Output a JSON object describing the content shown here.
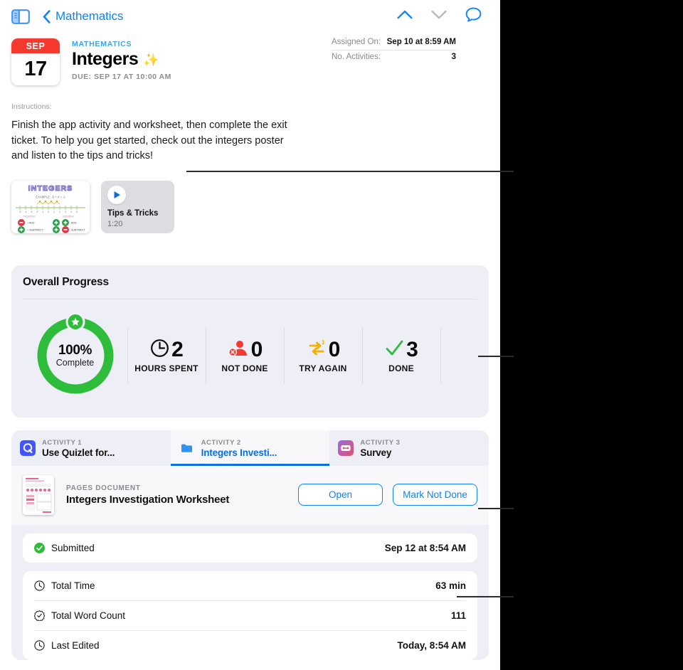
{
  "navbar": {
    "sidebar_toggle_icon": "sidebar-left-icon",
    "back_icon": "chevron-left-icon",
    "back_label": "Mathematics",
    "prev_icon": "chevron-up-icon",
    "next_icon": "chevron-down-icon",
    "comment_icon": "comment-bubble-icon",
    "accent": "#0a84ff",
    "disabled": "#b6b6bb"
  },
  "assignment": {
    "calendar": {
      "month": "SEP",
      "day": "17",
      "month_bg": "#f5392e"
    },
    "course": "MATHEMATICS",
    "title": "Integers",
    "sparkle_icon": "sparkles-icon",
    "sparkle_glyph": "✨",
    "due": "DUE: SEP 17 AT 10:00 AM"
  },
  "meta": {
    "rows": [
      {
        "key": "Assigned On:",
        "value": "Sep 10 at 8:59 AM"
      },
      {
        "key": "No. Activities:",
        "value": "3"
      }
    ]
  },
  "instructions": {
    "label": "Instructions:",
    "body": "Finish the app activity and worksheet, then complete the exit ticket. To help you get started, check out the integers poster and listen to the tips and tricks!"
  },
  "attachments": {
    "poster": {
      "name": "integers-poster-thumbnail",
      "heading": "INTEGERS",
      "example": "EXAMPLE: -5 + 4 = -1",
      "left_label": "negative",
      "right_label": "positive",
      "rules": [
        "+ ADD",
        "+ SUBTRACT",
        "+ ADD",
        "+ SUBTRACT"
      ]
    },
    "video": {
      "name": "tips-and-tricks-video",
      "play_icon": "play-icon",
      "title": "Tips & Tricks",
      "duration": "1:20"
    }
  },
  "progress": {
    "heading": "Overall Progress",
    "ring": {
      "percent": 100,
      "percent_label": "100%",
      "sub_label": "Complete",
      "color": "#2ebd3b",
      "star_icon": "star-badge-icon"
    },
    "stats": [
      {
        "icon": "clock-icon",
        "value": "2",
        "label": "HOURS SPENT",
        "color": "#0a0a0a"
      },
      {
        "icon": "person-x-icon",
        "value": "0",
        "label": "NOT DONE",
        "color": "#f5392e"
      },
      {
        "icon": "try-again-icon",
        "value": "0",
        "label": "TRY AGAIN",
        "color": "#f5b000"
      },
      {
        "icon": "checkmark-icon",
        "value": "3",
        "label": "DONE",
        "color": "#2ebd3b"
      }
    ]
  },
  "activities": {
    "tabs": [
      {
        "key": "ACTIVITY 1",
        "label": "Use Quizlet for...",
        "icon": "quizlet-app-icon",
        "active": false
      },
      {
        "key": "ACTIVITY 2",
        "label": "Integers Investi...",
        "icon": "pages-folder-icon",
        "active": true
      },
      {
        "key": "ACTIVITY 3",
        "label": "Survey",
        "icon": "survey-app-icon",
        "active": false
      }
    ],
    "document": {
      "thumb_name": "worksheet-thumbnail",
      "kind": "PAGES DOCUMENT",
      "title": "Integers Investigation Worksheet",
      "open_label": "Open",
      "mark_label": "Mark Not Done"
    },
    "submitted": {
      "icon": "check-circle-icon",
      "label": "Submitted",
      "value": "Sep 12 at 8:54 AM",
      "icon_color": "#2ebd3b"
    },
    "details": [
      {
        "icon": "clock-icon",
        "label": "Total Time",
        "value": "63 min"
      },
      {
        "icon": "seal-check-icon",
        "label": "Total Word Count",
        "value": "111"
      },
      {
        "icon": "clock-icon",
        "label": "Last Edited",
        "value": "Today, 8:54 AM"
      }
    ]
  },
  "callouts": {
    "count": 4,
    "line_color": "#2b2b2b"
  }
}
